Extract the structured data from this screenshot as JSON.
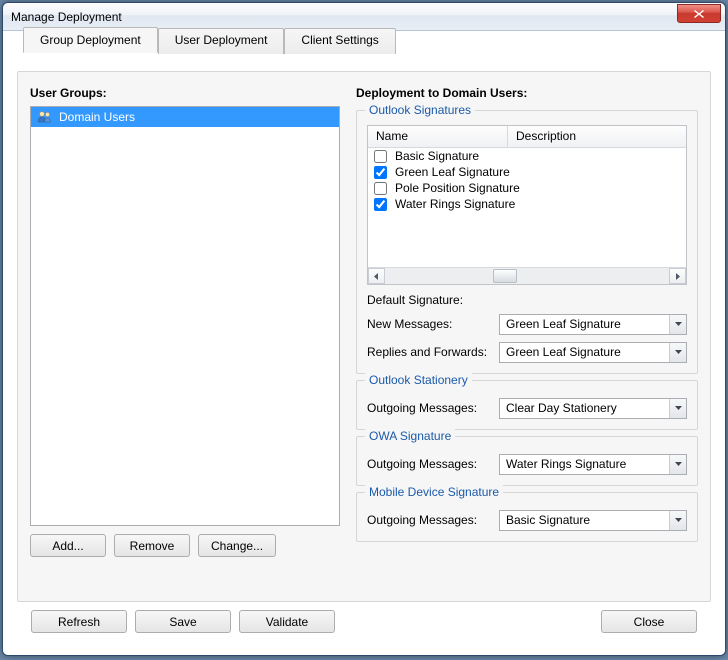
{
  "window": {
    "title": "Manage Deployment"
  },
  "tabs": [
    {
      "label": "Group Deployment",
      "active": true
    },
    {
      "label": "User Deployment",
      "active": false
    },
    {
      "label": "Client Settings",
      "active": false
    }
  ],
  "left": {
    "heading": "User Groups:",
    "items": [
      {
        "label": "Domain Users",
        "selected": true
      }
    ],
    "buttons": {
      "add": "Add...",
      "remove": "Remove",
      "change": "Change..."
    }
  },
  "right": {
    "heading": "Deployment to Domain Users:",
    "signatures_group": {
      "legend": "Outlook Signatures",
      "columns": {
        "name": "Name",
        "description": "Description"
      },
      "rows": [
        {
          "name": "Basic Signature",
          "checked": false
        },
        {
          "name": "Green Leaf Signature",
          "checked": true
        },
        {
          "name": "Pole Position Signature",
          "checked": false
        },
        {
          "name": "Water Rings Signature",
          "checked": true
        }
      ],
      "default_label": "Default Signature:",
      "new_messages_label": "New Messages:",
      "new_messages_value": "Green Leaf Signature",
      "replies_label": "Replies and Forwards:",
      "replies_value": "Green Leaf Signature"
    },
    "stationery_group": {
      "legend": "Outlook Stationery",
      "outgoing_label": "Outgoing Messages:",
      "outgoing_value": "Clear Day Stationery"
    },
    "owa_group": {
      "legend": "OWA Signature",
      "outgoing_label": "Outgoing Messages:",
      "outgoing_value": "Water Rings Signature"
    },
    "mobile_group": {
      "legend": "Mobile Device Signature",
      "outgoing_label": "Outgoing Messages:",
      "outgoing_value": "Basic Signature"
    }
  },
  "footer": {
    "refresh": "Refresh",
    "save": "Save",
    "validate": "Validate",
    "close": "Close"
  }
}
